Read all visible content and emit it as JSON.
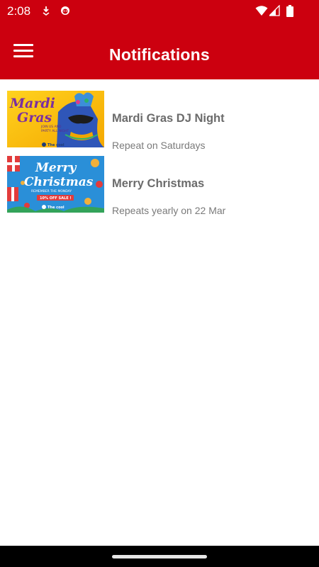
{
  "status_bar": {
    "time": "2:08",
    "notification_icons": [
      "download-icon",
      "face-icon"
    ],
    "system_icons": [
      "wifi-icon",
      "signal-icon",
      "battery-icon"
    ]
  },
  "app_bar": {
    "title": "Notifications",
    "menu_icon": "hamburger-menu-icon",
    "color": "#cc000f"
  },
  "notifications": [
    {
      "title": "Mardi Gras DJ Night",
      "schedule": "Repeat on Saturdays",
      "image_text": [
        "Mardi",
        "Gras",
        "JOIN US AND",
        "PARTY ALL NIGHT",
        "The cool"
      ]
    },
    {
      "title": "Merry Christmas",
      "schedule": "Repeats yearly on 22 Mar",
      "image_text": [
        "Merry",
        "Christmas",
        "REMEMBER THE MONDAY",
        "10% OFF SALE !",
        "The cool"
      ]
    }
  ]
}
